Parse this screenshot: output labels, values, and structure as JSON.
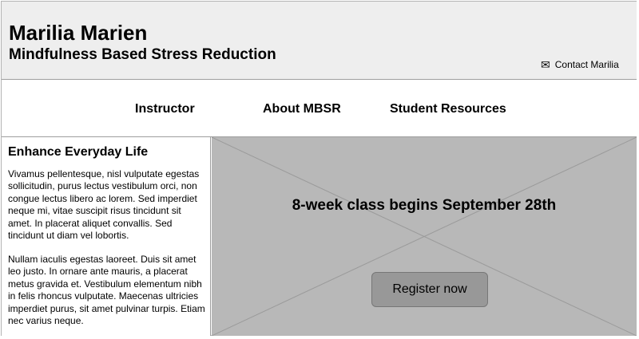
{
  "header": {
    "title": "Marilia Marien",
    "subtitle": "Mindfulness Based Stress Reduction",
    "contact": {
      "icon": "envelope-icon",
      "label": "Contact Marilia"
    }
  },
  "nav": {
    "items": [
      {
        "label": "Instructor"
      },
      {
        "label": "About MBSR"
      },
      {
        "label": "Student Resources"
      }
    ]
  },
  "sidebar": {
    "heading": "Enhance Everyday Life",
    "paragraphs": [
      "Vivamus pellentesque, nisl vulputate egestas sollicitudin, purus lectus vestibulum orci, non congue lectus libero ac lorem. Sed imperdiet neque mi, vitae suscipit risus tincidunt sit amet. In placerat aliquet convallis. Sed tincidunt ut diam vel lobortis.",
      "Nullam iaculis egestas laoreet. Duis sit amet leo justo. In ornare ante mauris, a placerat metus gravida et. Vestibulum elementum nibh in felis rhoncus vulputate. Maecenas ultricies imperdiet purus, sit amet pulvinar turpis. Etiam nec varius neque."
    ]
  },
  "hero": {
    "heading": "8-week class begins September 28th",
    "button_label": "Register now"
  },
  "colors": {
    "header_bg": "#eeeeee",
    "hero_bg": "#b8b8b8",
    "button_bg": "#989898",
    "border": "#9e9e9e"
  }
}
